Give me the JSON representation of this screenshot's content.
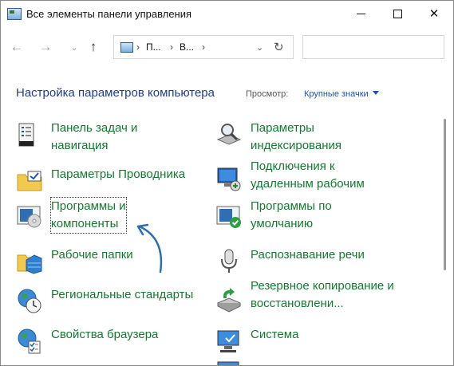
{
  "window": {
    "title": "Все элементы панели управления",
    "controls": {
      "minimize": "minimize",
      "maximize": "maximize",
      "close": "✕"
    }
  },
  "nav": {
    "breadcrumbs": [
      "П...",
      "В..."
    ],
    "search_placeholder": ""
  },
  "header": {
    "title": "Настройка параметров компьютера",
    "view_label": "Просмотр:",
    "view_value": "Крупные значки"
  },
  "items": [
    {
      "label": "Панель задач и\nнавигация",
      "icon": "taskbar-icon"
    },
    {
      "label": "Параметры\nиндексирования",
      "icon": "indexing-icon"
    },
    {
      "label": "Параметры Проводника",
      "icon": "explorer-options-icon"
    },
    {
      "label": "Подключения к\nудаленным рабочим",
      "icon": "remote-desktop-icon"
    },
    {
      "label": "Программы и\nкомпоненты",
      "icon": "programs-features-icon",
      "selected": true
    },
    {
      "label": "Программы по\nумолчанию",
      "icon": "default-programs-icon"
    },
    {
      "label": "Рабочие папки",
      "icon": "work-folders-icon"
    },
    {
      "label": "Распознавание речи",
      "icon": "speech-recognition-icon"
    },
    {
      "label": "Региональные стандарты",
      "icon": "region-icon"
    },
    {
      "label": "Резервное копирование и\nвосстановлени...",
      "icon": "backup-restore-icon"
    },
    {
      "label": "Свойства браузера",
      "icon": "internet-options-icon"
    },
    {
      "label": "Система",
      "icon": "system-icon"
    }
  ],
  "colors": {
    "heading": "#1e3d8f",
    "item_text": "#137a2f",
    "link": "#1a55b8",
    "annotation_arrow": "#2c6fb0"
  }
}
